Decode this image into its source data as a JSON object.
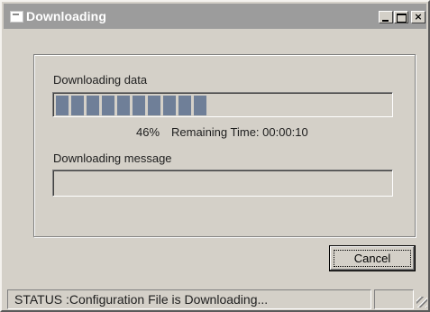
{
  "window": {
    "title": "Downloading"
  },
  "titlebar_buttons": {
    "minimize": "_",
    "maximize": "□",
    "close": "×"
  },
  "progress_section": {
    "label": "Downloading data",
    "percent_text": "46%",
    "progress_fraction": 0.46,
    "remaining_text": "Remaining Time: 00:00:10"
  },
  "message_section": {
    "label": "Downloading message",
    "value": ""
  },
  "buttons": {
    "cancel_label": "Cancel"
  },
  "status_bar": {
    "status_text": "STATUS :Configuration File is Downloading..."
  },
  "colors": {
    "face": "#d4d0c8",
    "titlebar": "#9c9c9c",
    "progress_fill": "#6f7f98"
  }
}
